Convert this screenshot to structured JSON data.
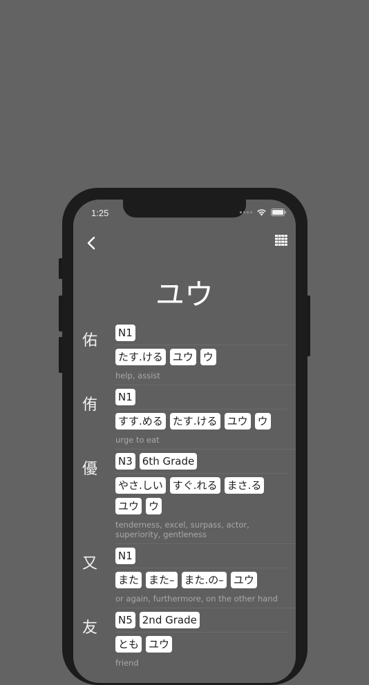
{
  "status": {
    "time": "1:25"
  },
  "header": {
    "title": "ユウ"
  },
  "icons": {
    "back": "chevron-left-icon",
    "grid": "grid-icon",
    "wifi": "wifi-icon",
    "battery": "battery-icon"
  },
  "entries": [
    {
      "kanji": "佑",
      "levels": [
        "N1"
      ],
      "readings": [
        "たす.ける",
        "ユウ",
        "ウ"
      ],
      "meaning": "help, assist"
    },
    {
      "kanji": "侑",
      "levels": [
        "N1"
      ],
      "readings": [
        "すす.める",
        "たす.ける",
        "ユウ",
        "ウ"
      ],
      "meaning": "urge to eat"
    },
    {
      "kanji": "優",
      "levels": [
        "N3",
        "6th Grade"
      ],
      "readings": [
        "やさ.しい",
        "すぐ.れる",
        "まさ.る",
        "ユウ",
        "ウ"
      ],
      "meaning": "tenderness, excel, surpass, actor, superiority, gentleness"
    },
    {
      "kanji": "又",
      "levels": [
        "N1"
      ],
      "readings": [
        "また",
        "また–",
        "また.の–",
        "ユウ"
      ],
      "meaning": "or again, furthermore, on the other hand"
    },
    {
      "kanji": "友",
      "levels": [
        "N5",
        "2nd Grade"
      ],
      "readings": [
        "とも",
        "ユウ"
      ],
      "meaning": "friend"
    }
  ]
}
